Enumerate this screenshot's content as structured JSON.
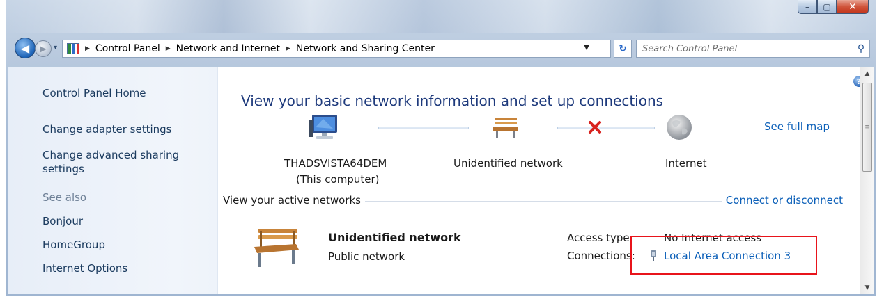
{
  "window": {
    "minimize_glyph": "–",
    "maximize_glyph": "▢",
    "close_glyph": "✕"
  },
  "navigation": {
    "back_glyph": "◀",
    "forward_glyph": "▶",
    "history_glyph": "▾",
    "breadcrumbs": [
      "Control Panel",
      "Network and Internet",
      "Network and Sharing Center"
    ],
    "separator_glyph": "▶",
    "dropdown_glyph": "▼",
    "refresh_glyph": "↻",
    "search_placeholder": "Search Control Panel",
    "search_glyph": "⚲"
  },
  "sidebar": {
    "items": [
      {
        "label": "Control Panel Home",
        "link": true
      },
      {
        "label": "Change adapter settings",
        "link": true
      },
      {
        "label": "Change advanced sharing\nsettings",
        "link": true
      },
      {
        "label": "See also",
        "link": false
      },
      {
        "label": "Bonjour",
        "link": true
      },
      {
        "label": "HomeGroup",
        "link": true
      },
      {
        "label": "Internet Options",
        "link": true
      }
    ]
  },
  "main": {
    "heading": "View your basic network information and set up connections",
    "help_glyph": "?",
    "see_full_map": "See full map",
    "map": {
      "computer_name": "THADSVISTA64DEM",
      "computer_sub": "(This computer)",
      "network_name": "Unidentified network",
      "internet_label": "Internet"
    },
    "active_networks_title": "View your active networks",
    "connect_link": "Connect or disconnect",
    "active_network": {
      "name": "Unidentified network",
      "type": "Public network",
      "access_type_label": "Access type:",
      "access_type_value": "No Internet access",
      "connections_label": "Connections:",
      "connection_link": "Local Area Connection 3"
    }
  },
  "scrollbar": {
    "up_glyph": "▲",
    "down_glyph": "▼",
    "grip_glyph": "≡"
  },
  "colors": {
    "link": "#0b5fb8",
    "heading": "#1e3a7c",
    "highlight": "#e8141b"
  }
}
